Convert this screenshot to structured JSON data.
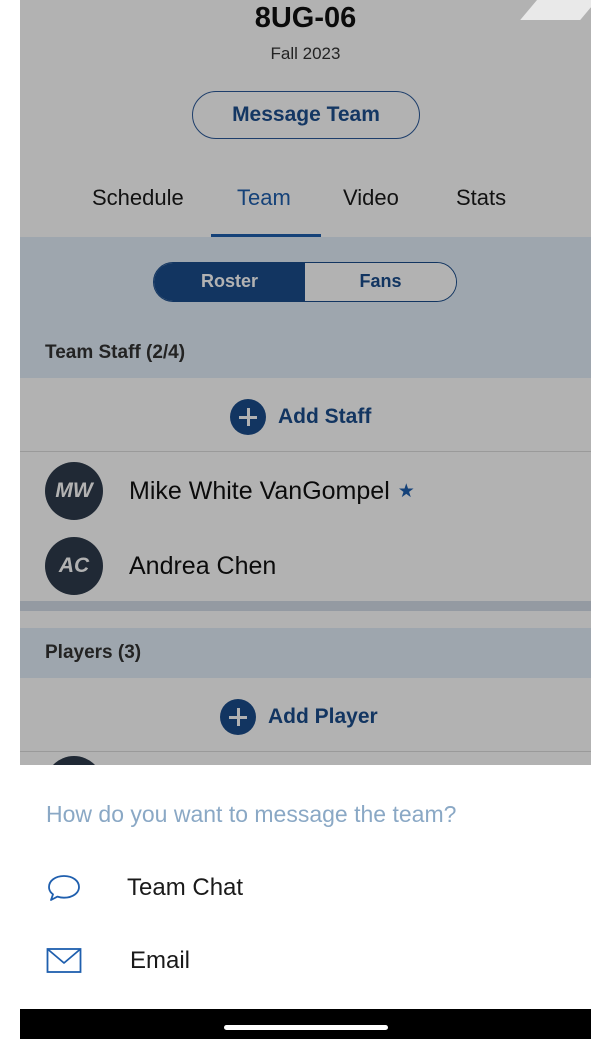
{
  "header": {
    "team_name": "8UG-06",
    "season": "Fall 2023",
    "message_button": "Message Team"
  },
  "tabs": [
    {
      "label": "Schedule",
      "active": false
    },
    {
      "label": "Team",
      "active": true
    },
    {
      "label": "Video",
      "active": false
    },
    {
      "label": "Stats",
      "active": false
    }
  ],
  "segment": {
    "roster": "Roster",
    "fans": "Fans",
    "selected": "Roster"
  },
  "staff": {
    "heading": "Team Staff (2/4)",
    "add_label": "Add Staff",
    "members": [
      {
        "initials": "MW",
        "name": "Mike White VanGompel",
        "starred": true
      },
      {
        "initials": "AC",
        "name": "Andrea Chen",
        "starred": false
      }
    ]
  },
  "players": {
    "heading": "Players (3)",
    "add_label": "Add Player"
  },
  "sheet": {
    "prompt": "How do you want to message the team?",
    "options": [
      {
        "label": "Team Chat",
        "icon": "chat-bubble-icon"
      },
      {
        "label": "Email",
        "icon": "envelope-icon"
      }
    ]
  },
  "colors": {
    "brand": "#1b4d8c",
    "accent": "#1f5fae",
    "section_bg": "#e3eef9",
    "prompt_text": "#8aa8c5"
  }
}
